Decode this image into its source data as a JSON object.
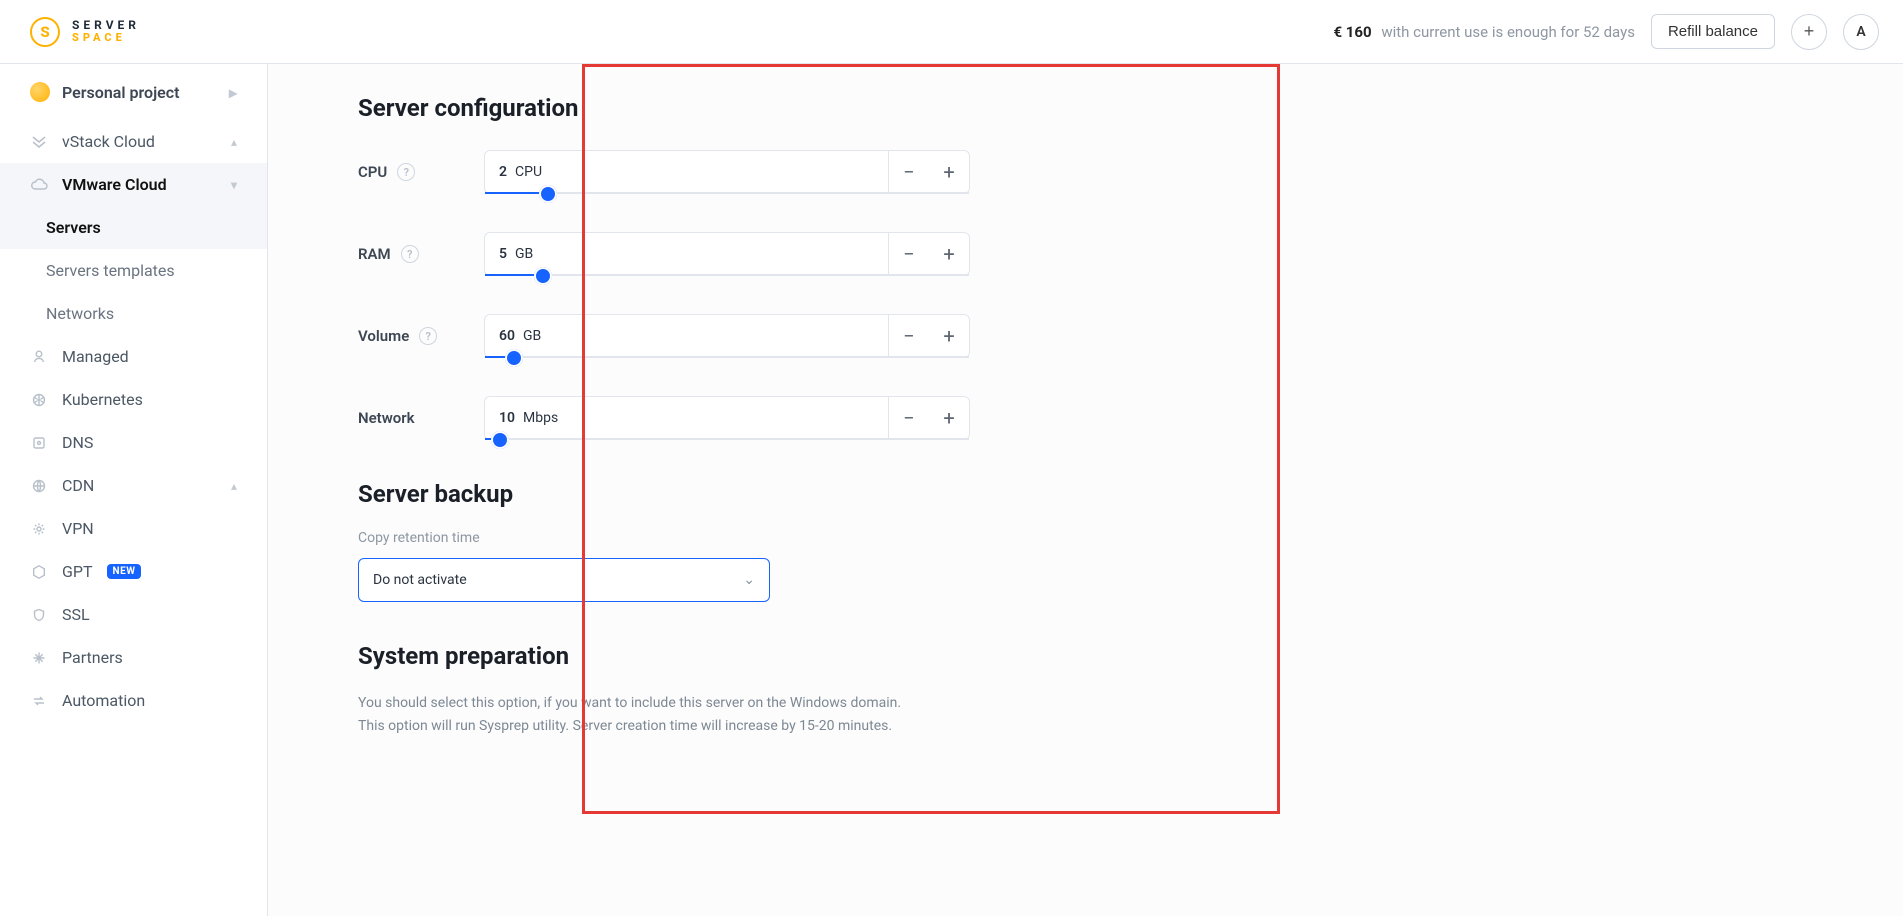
{
  "header": {
    "brand_line1": "SERVER",
    "brand_line2": "SPACE",
    "brand_mark": "S",
    "balance_amount": "€ 160",
    "balance_text": "with current use is enough for 52 days",
    "refill_label": "Refill balance",
    "plus": "+",
    "avatar_initial": "A"
  },
  "sidebar": {
    "project": "Personal project",
    "groups": {
      "vstack": "vStack Cloud",
      "vmware": "VMware Cloud"
    },
    "vmware_items": {
      "servers": "Servers",
      "templates": "Servers templates",
      "networks": "Networks"
    },
    "items": {
      "managed": "Managed",
      "kubernetes": "Kubernetes",
      "dns": "DNS",
      "cdn": "CDN",
      "vpn": "VPN",
      "gpt": "GPT",
      "gpt_badge": "NEW",
      "ssl": "SSL",
      "partners": "Partners",
      "automation": "Automation"
    }
  },
  "content": {
    "title_config": "Server configuration",
    "rows": {
      "cpu": {
        "label": "CPU",
        "value": "2",
        "unit": "CPU",
        "fillPercent": 13
      },
      "ram": {
        "label": "RAM",
        "value": "5",
        "unit": "GB",
        "fillPercent": 12
      },
      "volume": {
        "label": "Volume",
        "value": "60",
        "unit": "GB",
        "fillPercent": 6
      },
      "network": {
        "label": "Network",
        "value": "10",
        "unit": "Mbps",
        "fillPercent": 3
      }
    },
    "title_backup": "Server backup",
    "backup_label": "Copy retention time",
    "backup_selected": "Do not activate",
    "title_prep": "System preparation",
    "prep_desc": "You should select this option, if you want to include this server on the Windows domain. This option will run Sysprep utility. Server creation time will increase by 15-20 minutes."
  },
  "glyphs": {
    "minus": "−",
    "plus": "+",
    "hint": "?",
    "chevron_right": "▸",
    "chevron_up_small": "▴",
    "chevron_down_small": "▾",
    "chevron_down": "⌄"
  }
}
